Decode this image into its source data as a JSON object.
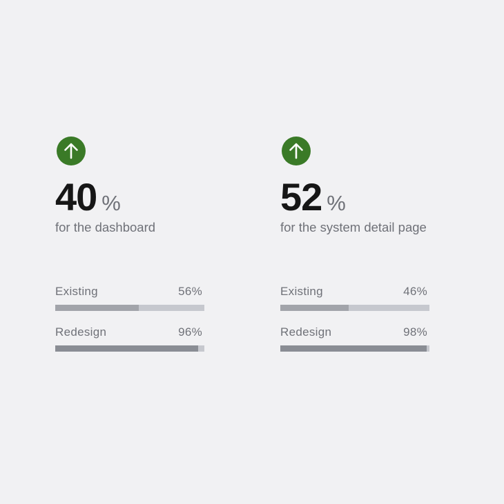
{
  "colors": {
    "background": "#f1f1f3",
    "accent_up": "#3a7a27",
    "headline": "#161616",
    "muted_text": "#6f7178",
    "track": "#c6c8ce",
    "fill_existing": "#a2a4aa",
    "fill_redesign": "#8a8d94"
  },
  "chart_data": [
    {
      "type": "bar",
      "orientation": "horizontal",
      "icon": "arrow-up-circle-icon",
      "headline_value": "40",
      "headline_unit": "%",
      "caption": "for the dashboard",
      "categories": [
        "Existing",
        "Redesign"
      ],
      "values": [
        56,
        96
      ],
      "value_labels": [
        "56%",
        "96%"
      ],
      "xlim": [
        0,
        100
      ]
    },
    {
      "type": "bar",
      "orientation": "horizontal",
      "icon": "arrow-up-circle-icon",
      "headline_value": "52",
      "headline_unit": "%",
      "caption": "for the system detail page",
      "categories": [
        "Existing",
        "Redesign"
      ],
      "values": [
        46,
        98
      ],
      "value_labels": [
        "46%",
        "98%"
      ],
      "xlim": [
        0,
        100
      ]
    }
  ]
}
